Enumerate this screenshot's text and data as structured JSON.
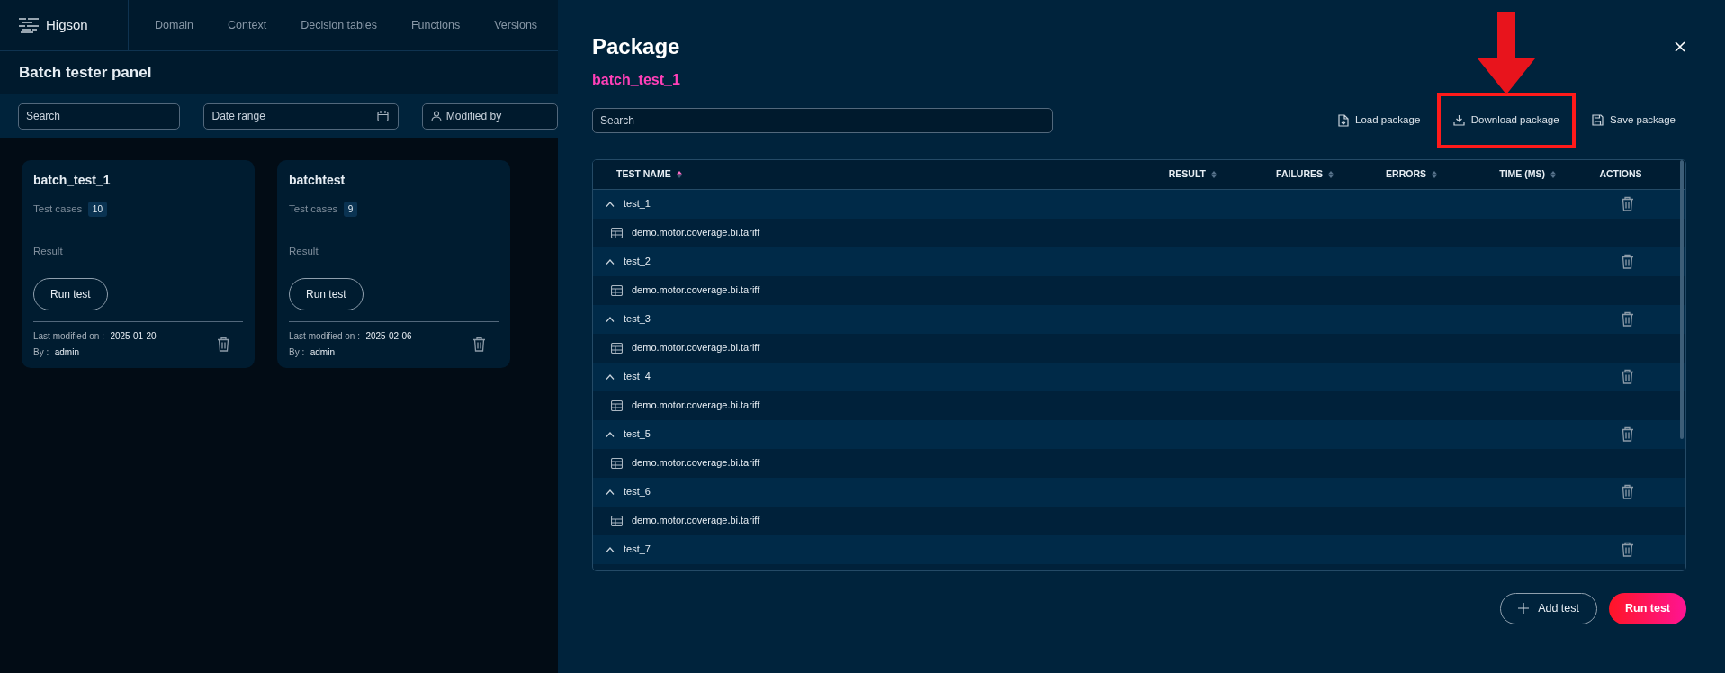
{
  "app": {
    "brand": "Higson",
    "nav": [
      {
        "label": "Domain"
      },
      {
        "label": "Context"
      },
      {
        "label": "Decision tables"
      },
      {
        "label": "Functions"
      },
      {
        "label": "Versions"
      }
    ]
  },
  "page": {
    "title": "Batch tester panel",
    "search_placeholder": "Search",
    "date_placeholder": "Date range",
    "user_placeholder": "Modified by"
  },
  "cards": [
    {
      "title": "batch_test_1",
      "cases_label": "Test cases",
      "cases": "10",
      "result_label": "Result",
      "button": "Run test",
      "modified_label": "Last modified on :",
      "modified": "2025-01-20",
      "by_label": "By :",
      "by": "admin"
    },
    {
      "title": "batchtest",
      "cases_label": "Test cases",
      "cases": "9",
      "result_label": "Result",
      "button": "Run test",
      "modified_label": "Last modified on :",
      "modified": "2025-02-06",
      "by_label": "By :",
      "by": "admin"
    }
  ],
  "modal": {
    "title": "Package",
    "package_name": "batch_test_1",
    "search_placeholder": "Search",
    "actions": [
      {
        "kind": "load",
        "label": "Load package",
        "highlighted": false
      },
      {
        "kind": "download",
        "label": "Download package",
        "highlighted": true
      },
      {
        "kind": "save",
        "label": "Save package",
        "highlighted": false
      }
    ],
    "table": {
      "columns": [
        {
          "label": "TEST NAME",
          "sorted": true
        },
        {
          "label": "RESULT",
          "sorted": false
        },
        {
          "label": "FAILURES",
          "sorted": false
        },
        {
          "label": "ERRORS",
          "sorted": false
        },
        {
          "label": "TIME (MS)",
          "sorted": false
        },
        {
          "label": "ACTIONS",
          "kind": "actions"
        }
      ],
      "rows": [
        {
          "name": "test_1",
          "expanded": true,
          "children": [
            {
              "name": "demo.motor.coverage.bi.tariff"
            }
          ]
        },
        {
          "name": "test_2",
          "expanded": true,
          "children": [
            {
              "name": "demo.motor.coverage.bi.tariff"
            }
          ]
        },
        {
          "name": "test_3",
          "expanded": true,
          "children": [
            {
              "name": "demo.motor.coverage.bi.tariff"
            }
          ]
        },
        {
          "name": "test_4",
          "expanded": true,
          "children": [
            {
              "name": "demo.motor.coverage.bi.tariff"
            }
          ]
        },
        {
          "name": "test_5",
          "expanded": true,
          "children": [
            {
              "name": "demo.motor.coverage.bi.tariff"
            }
          ]
        },
        {
          "name": "test_6",
          "expanded": true,
          "children": [
            {
              "name": "demo.motor.coverage.bi.tariff"
            }
          ]
        },
        {
          "name": "test_7",
          "expanded": true
        }
      ]
    },
    "buttons": [
      {
        "kind": "add",
        "label": "Add test"
      },
      {
        "kind": "run",
        "label": "Run test"
      }
    ]
  }
}
